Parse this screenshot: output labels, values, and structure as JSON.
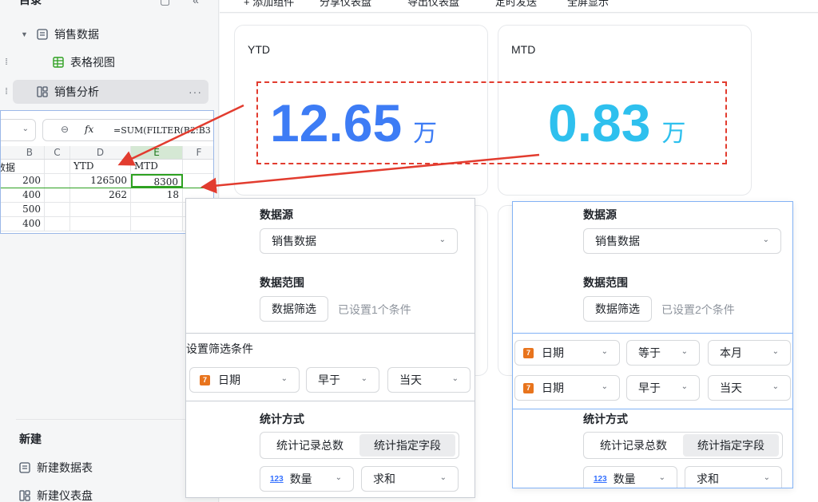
{
  "sidebar": {
    "head": "目录",
    "items": [
      {
        "label": "销售数据"
      },
      {
        "label": "表格视图"
      },
      {
        "label": "销售分析"
      }
    ],
    "new_section": "新建",
    "new_table": "新建数据表",
    "new_dashboard": "新建仪表盘"
  },
  "toolbar": {
    "add": "+ 添加组件",
    "share": "分享仪表盘",
    "export": "导出仪表盘",
    "schedule": "定时发送",
    "fullscreen": "全屏显示"
  },
  "cards": {
    "ytd": {
      "title": "YTD",
      "value": "12.65",
      "unit": "万",
      "color": "#3d7cf5"
    },
    "mtd": {
      "title": "MTD",
      "value": "0.83",
      "unit": "万",
      "color": "#2ec0ee"
    }
  },
  "sheet": {
    "formula": "=SUM(FILTER(B2:B3",
    "col_headers": [
      "B",
      "C",
      "D",
      "E",
      "F"
    ],
    "header_row": {
      "B": "数据",
      "D": "YTD",
      "E": "MTD"
    },
    "rows": [
      {
        "B": "200",
        "D": "126500",
        "E": "8300"
      },
      {
        "B": "400",
        "D": "262",
        "E": "18"
      },
      {
        "B": "500",
        "D": "",
        "E": ""
      },
      {
        "B": "400",
        "D": "",
        "E": ""
      }
    ]
  },
  "panel_left": {
    "source_label": "数据源",
    "source_value": "销售数据",
    "range_label": "数据范围",
    "filter_btn": "数据筛选",
    "filter_hint": "已设置1个条件",
    "cond_title": "设置筛选条件",
    "cond": {
      "field": "日期",
      "op": "早于",
      "value": "当天"
    },
    "stat_label": "统计方式",
    "stat_opt1": "统计记录总数",
    "stat_opt2": "统计指定字段",
    "field": "数量",
    "agg": "求和"
  },
  "panel_right": {
    "source_label": "数据源",
    "source_value": "销售数据",
    "range_label": "数据范围",
    "filter_btn": "数据筛选",
    "filter_hint": "已设置2个条件",
    "cond1": {
      "field": "日期",
      "op": "等于",
      "value": "本月"
    },
    "cond2": {
      "field": "日期",
      "op": "早于",
      "value": "当天"
    },
    "stat_label": "统计方式",
    "stat_opt1": "统计记录总数",
    "stat_opt2": "统计指定字段",
    "field": "数量",
    "agg": "求和"
  },
  "colors": {
    "accent_blue": "#3d7cf5",
    "accent_cyan": "#2ec0ee",
    "arrow_red": "#e23c2f",
    "date_badge": "#e8741d"
  },
  "icons": [
    "table-list-icon",
    "grid-view-icon",
    "dashboard-icon",
    "zoom-icon",
    "fx-icon",
    "chevron-down-icon",
    "date-field-icon",
    "number-field-icon",
    "more-icon",
    "drag-handle-icon"
  ]
}
